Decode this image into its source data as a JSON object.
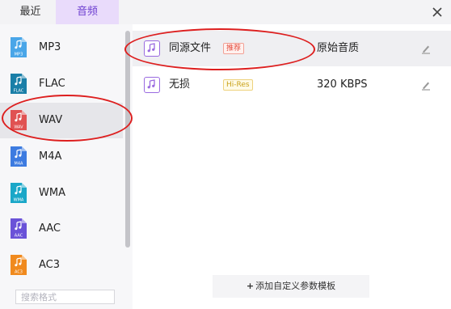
{
  "tabs": {
    "recent": "最近",
    "audio": "音频"
  },
  "formats": [
    {
      "label": "MP3",
      "badge": "MP3",
      "color": "#4aa6e8",
      "icon": "mp3-file-icon"
    },
    {
      "label": "FLAC",
      "badge": "FLAC",
      "color": "#1a7fa8",
      "icon": "flac-file-icon"
    },
    {
      "label": "WAV",
      "badge": "WAV",
      "color": "#e05252",
      "icon": "wav-file-icon"
    },
    {
      "label": "M4A",
      "badge": "M4A",
      "color": "#3d7be0",
      "icon": "m4a-file-icon"
    },
    {
      "label": "WMA",
      "badge": "WMA",
      "color": "#1aa7c8",
      "icon": "wma-file-icon"
    },
    {
      "label": "AAC",
      "badge": "AAC",
      "color": "#6a52d8",
      "icon": "aac-file-icon"
    },
    {
      "label": "AC3",
      "badge": "AC3",
      "color": "#f08a1e",
      "icon": "ac3-file-icon"
    }
  ],
  "selected_format": "WAV",
  "search": {
    "placeholder": "搜索格式",
    "value": ""
  },
  "presets": [
    {
      "name": "同源文件",
      "tag": "推荐",
      "quality": "原始音质"
    },
    {
      "name": "无损",
      "tag": "Hi-Res",
      "quality": "320 KBPS"
    }
  ],
  "add_button": "添加自定义参数模板",
  "colors": {
    "accent": "#6d3fd0",
    "tab_active_bg": "#e9dbfb",
    "annotation": "#dd1f1f"
  }
}
